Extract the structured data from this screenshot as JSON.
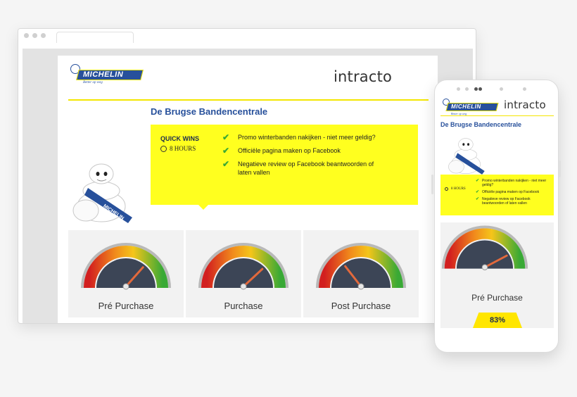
{
  "brand": {
    "logo_text": "MICHELIN",
    "logo_tagline": "Better op weg",
    "partner_logo": "intracto"
  },
  "slide": {
    "heading": "De Brugse Bandencentrale",
    "quick_wins": {
      "title": "QUICK WINS",
      "time_label": "8 HOURS",
      "items": [
        "Promo winterbanden nakijken - niet meer geldig?",
        "Officiële pagina maken op Facebook",
        "Negatieve review op Facebook beantwoorden of laten vallen"
      ]
    },
    "gauges": [
      {
        "label": "Pré Purchase",
        "value": 0.72
      },
      {
        "label": "Purchase",
        "value": 0.75
      },
      {
        "label": "Post Purchase",
        "value": 0.3
      }
    ]
  },
  "mobile": {
    "gauge_label": "Pré Purchase",
    "gauge_value": 0.83,
    "score_badge": "83%"
  },
  "colors": {
    "accent_yellow": "#f4e600",
    "brand_blue": "#27509b",
    "check_green": "#3ba935"
  }
}
